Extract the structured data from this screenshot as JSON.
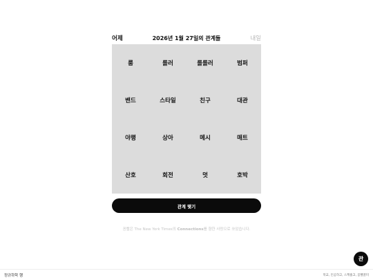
{
  "header": {
    "prev_label": "어제",
    "title": "2026년 1월 27일의 관계들",
    "next_label": "내일"
  },
  "grid": {
    "words": [
      "룸",
      "롤러",
      "롤롤러",
      "범퍼",
      "밴드",
      "스타일",
      "친구",
      "대관",
      "야행",
      "상아",
      "메시",
      "매트",
      "산호",
      "회전",
      "멋",
      "호박"
    ]
  },
  "connect_button": {
    "label": "관계 맺기"
  },
  "credit": {
    "before": "꽁빨은 The New York Times의 ",
    "strong": "Connections",
    "after": "를 향한 사랑으로 쏘았습니다."
  },
  "fab": {
    "label": "관"
  },
  "footer": {
    "brand": "정규하학 행",
    "links": "학교, 인공하고, 스케줄고, 꽁빨꿀미"
  }
}
